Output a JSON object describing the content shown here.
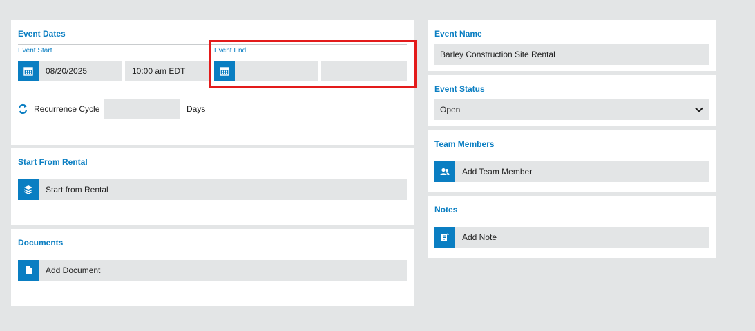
{
  "event_dates": {
    "title": "Event Dates",
    "start_label": "Event Start",
    "start_date": "08/20/2025",
    "start_time": "10:00 am EDT",
    "end_label": "Event End",
    "end_date": "",
    "end_time": "",
    "recurrence_label": "Recurrence Cycle",
    "recurrence_value": "",
    "recurrence_unit": "Days"
  },
  "start_from_rental": {
    "title": "Start From Rental",
    "button_label": "Start from Rental"
  },
  "documents": {
    "title": "Documents",
    "button_label": "Add Document"
  },
  "event_name": {
    "title": "Event Name",
    "value": "Barley Construction Site Rental"
  },
  "event_status": {
    "title": "Event Status",
    "value": "Open"
  },
  "team_members": {
    "title": "Team Members",
    "button_label": "Add Team Member"
  },
  "notes": {
    "title": "Notes",
    "button_label": "Add Note"
  },
  "colors": {
    "accent": "#0a7ec2",
    "highlight": "#e31b1b",
    "field_bg": "#e3e5e6"
  },
  "icons": {
    "calendar": "calendar-icon",
    "recurrence": "recurrence-icon",
    "layers": "layers-icon",
    "document": "document-icon",
    "users": "users-icon",
    "note": "note-icon",
    "chevron": "chevron-down-icon"
  }
}
